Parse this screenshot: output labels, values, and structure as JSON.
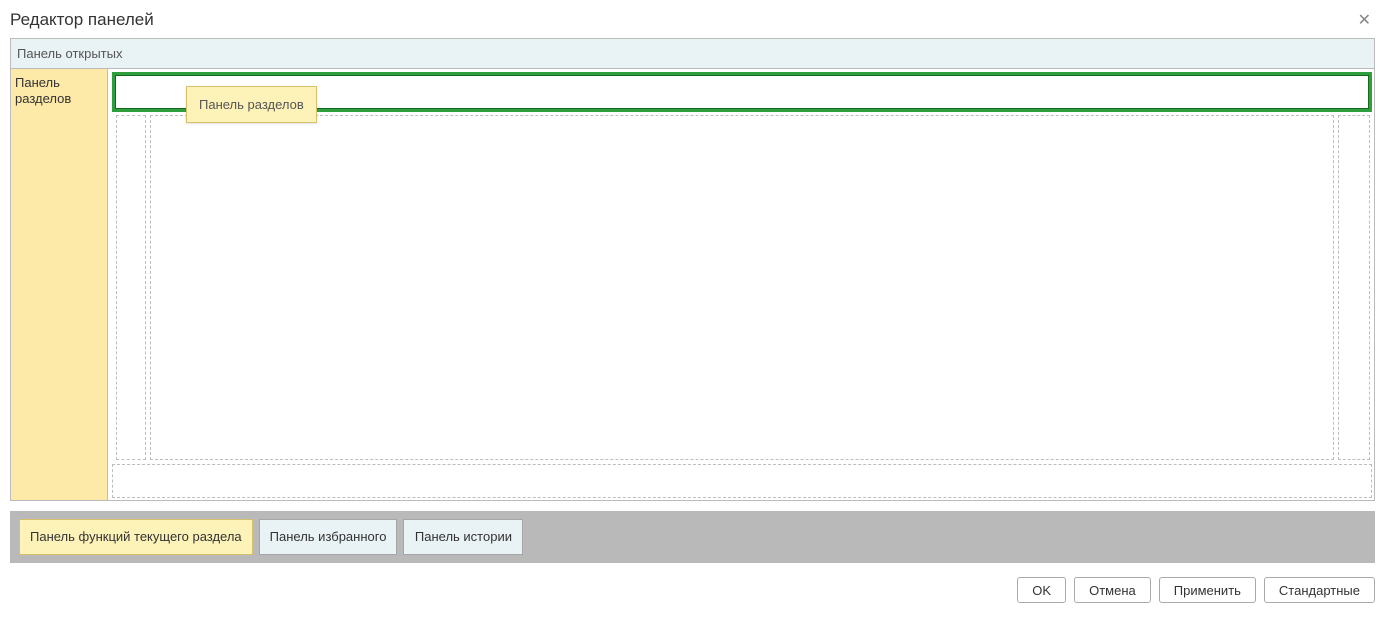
{
  "window": {
    "title": "Редактор панелей"
  },
  "layout": {
    "top_bar_label": "Панель открытых",
    "left_panel_label": "Панель разделов",
    "drag_ghost_label": "Панель разделов"
  },
  "palette": {
    "items": [
      {
        "label": "Панель функций текущего раздела",
        "variant": "yellow"
      },
      {
        "label": "Панель избранного",
        "variant": "blue"
      },
      {
        "label": "Панель истории",
        "variant": "blue"
      }
    ]
  },
  "buttons": {
    "ok": "OK",
    "cancel": "Отмена",
    "apply": "Применить",
    "standard": "Стандартные"
  }
}
